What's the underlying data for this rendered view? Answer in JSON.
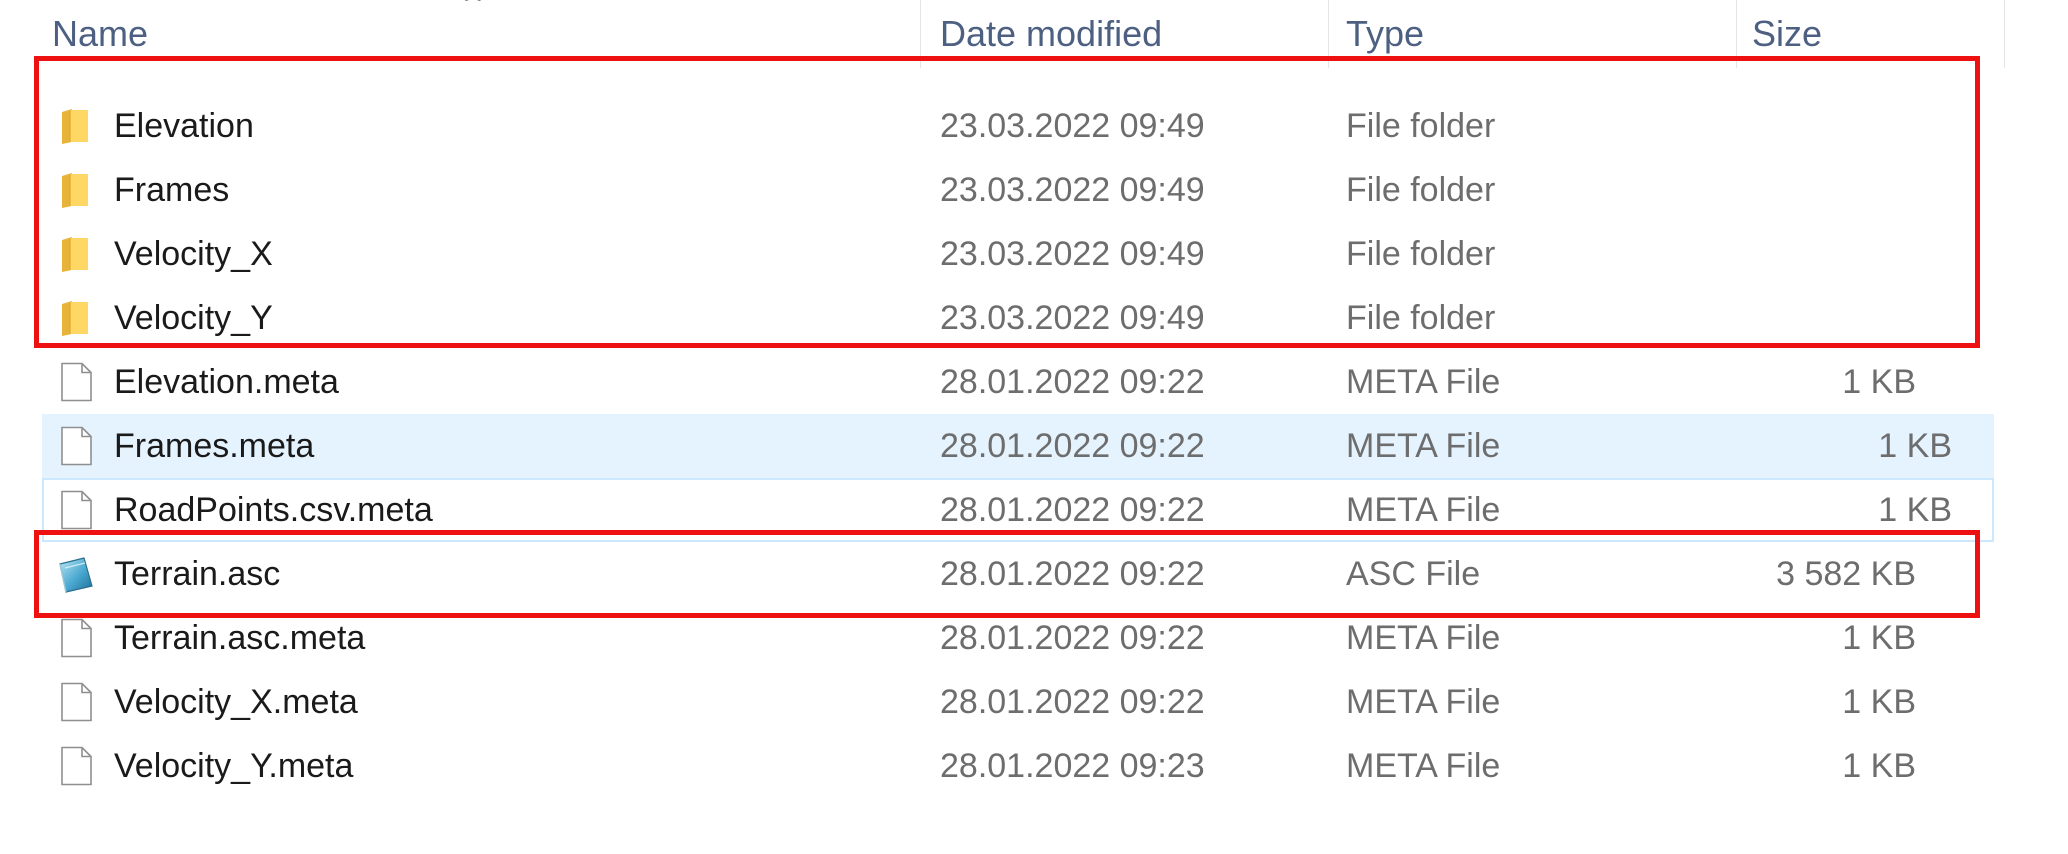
{
  "columns": {
    "name": "Name",
    "date": "Date modified",
    "type": "Type",
    "size": "Size"
  },
  "sort_indicator": "^",
  "files": [
    {
      "name": "Elevation",
      "date": "23.03.2022 09:49",
      "type": "File folder",
      "size": "",
      "icon": "folder-icon"
    },
    {
      "name": "Frames",
      "date": "23.03.2022 09:49",
      "type": "File folder",
      "size": "",
      "icon": "folder-icon"
    },
    {
      "name": "Velocity_X",
      "date": "23.03.2022 09:49",
      "type": "File folder",
      "size": "",
      "icon": "folder-icon"
    },
    {
      "name": "Velocity_Y",
      "date": "23.03.2022 09:49",
      "type": "File folder",
      "size": "",
      "icon": "folder-icon"
    },
    {
      "name": "Elevation.meta",
      "date": "28.01.2022 09:22",
      "type": "META File",
      "size": "1 KB",
      "icon": "blank-file-icon"
    },
    {
      "name": "Frames.meta",
      "date": "28.01.2022 09:22",
      "type": "META File",
      "size": "1 KB",
      "icon": "blank-file-icon"
    },
    {
      "name": "RoadPoints.csv.meta",
      "date": "28.01.2022 09:22",
      "type": "META File",
      "size": "1 KB",
      "icon": "blank-file-icon"
    },
    {
      "name": "Terrain.asc",
      "date": "28.01.2022 09:22",
      "type": "ASC File",
      "size": "3 582 KB",
      "icon": "asc-file-icon"
    },
    {
      "name": "Terrain.asc.meta",
      "date": "28.01.2022 09:22",
      "type": "META File",
      "size": "1 KB",
      "icon": "blank-file-icon"
    },
    {
      "name": "Velocity_X.meta",
      "date": "28.01.2022 09:22",
      "type": "META File",
      "size": "1 KB",
      "icon": "blank-file-icon"
    },
    {
      "name": "Velocity_Y.meta",
      "date": "28.01.2022 09:23",
      "type": "META File",
      "size": "1 KB",
      "icon": "blank-file-icon"
    }
  ],
  "colors": {
    "header_text": "#4d6082",
    "hover_background": "#e5f3ff",
    "focus_outline": "#cce8ff",
    "annotation_red": "#ee1111",
    "folder_yellow": "#f8d775"
  }
}
